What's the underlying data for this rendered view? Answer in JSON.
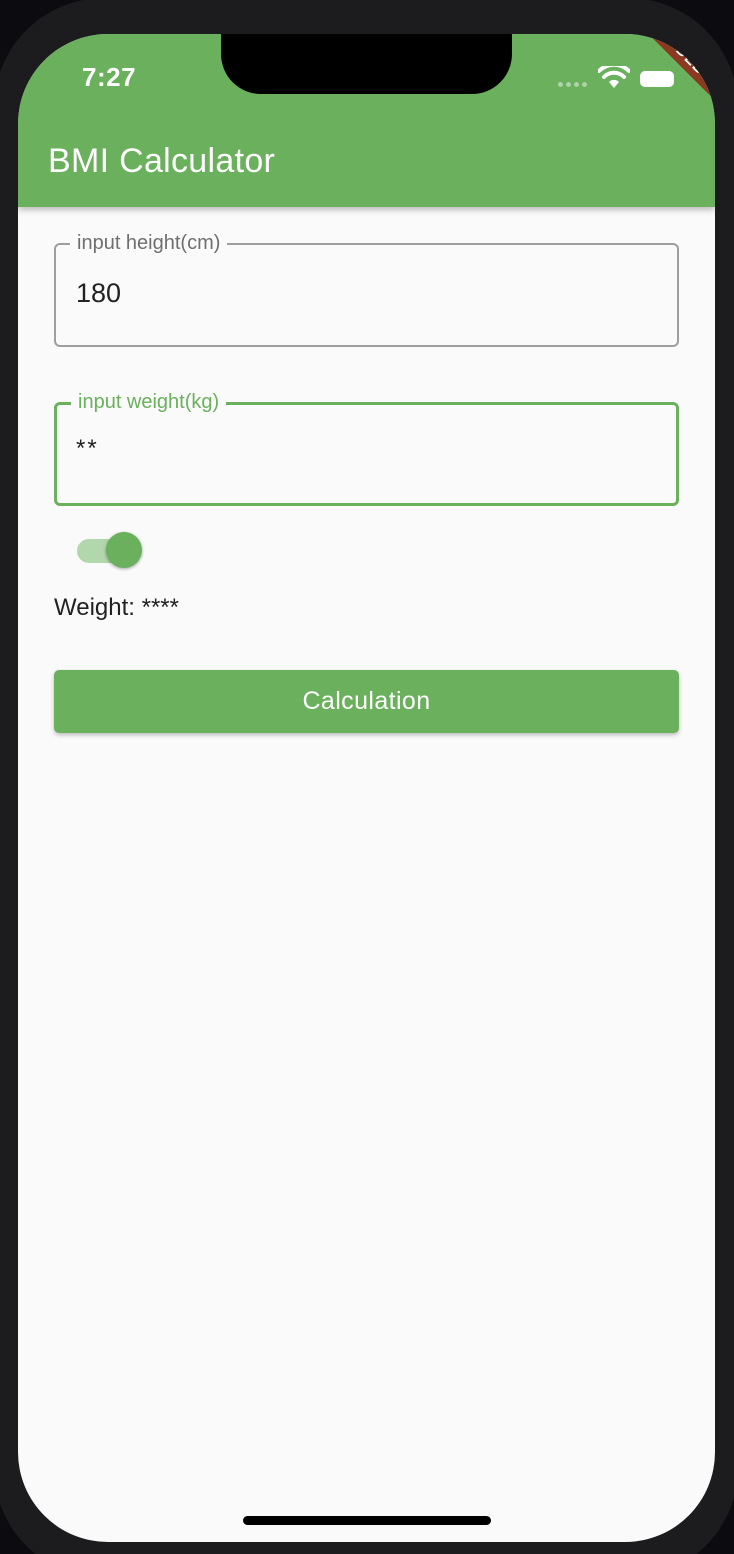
{
  "status_bar": {
    "time": "7:27",
    "debug_banner": "DEBUG"
  },
  "app_bar": {
    "title": "BMI Calculator",
    "color": "#6ab05d"
  },
  "height_field": {
    "label": "input height(cm)",
    "value": "180"
  },
  "weight_field": {
    "label": "input weight(kg)",
    "value": "**"
  },
  "toggle": {
    "on": true
  },
  "weight_display": {
    "text": "Weight: ****"
  },
  "calculate_button": {
    "label": "Calculation"
  },
  "icons": {
    "wifi": "wifi-icon",
    "battery": "battery-icon",
    "signal": "cellular-signal-icon"
  }
}
